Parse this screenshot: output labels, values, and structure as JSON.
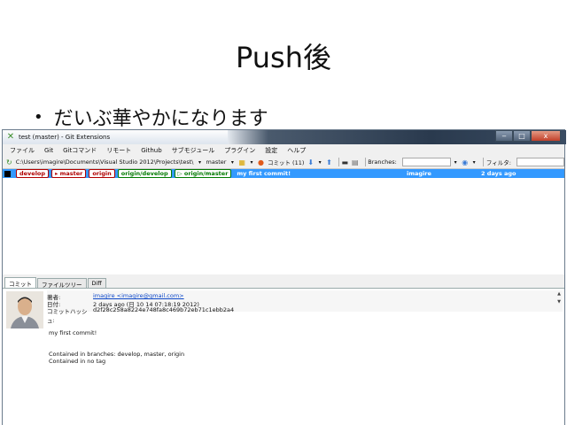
{
  "slide": {
    "title": "Push後",
    "bullet": "だいぶ華やかになります"
  },
  "window": {
    "title": "test (master) - Git Extensions",
    "controls": {
      "minimize": "‒",
      "maximize": "□",
      "close": "x"
    }
  },
  "menu": [
    "ファイル",
    "Git",
    "Gitコマンド",
    "リモート",
    "Github",
    "サブモジュール",
    "プラグイン",
    "設定",
    "ヘルプ"
  ],
  "toolbar": {
    "path": "C:\\Users\\imagire\\Documents\\Visual Studio 2012\\Projects\\test\\",
    "branch": "master",
    "commit_label": "コミット (11)",
    "branches_label": "Branches:",
    "filter_label": "フィルタ:"
  },
  "commits": [
    {
      "local_refs": [
        "develop",
        "master",
        "origin"
      ],
      "remote_refs": [
        "origin/develop",
        "origin/master"
      ],
      "message": "my first commit!",
      "author": "imagire",
      "date": "2 days ago"
    }
  ],
  "tabs": [
    "コミット",
    "ファイルツリー",
    "Diff"
  ],
  "details": {
    "author_label": "著者:",
    "author_value": "imagire <imagire@gmail.com>",
    "date_label": "日付:",
    "date_value": "2 days ago (日 10 14 07:18:19 2012)",
    "hash_label": "コミットハッシュ:",
    "hash_value": "d2f28c258a8224e748fa8c469b72eb71c1ebb2a4",
    "message": "my first commit!",
    "branches_line": "Contained in branches: develop, master, origin",
    "tags_line": "Contained in no tag"
  }
}
